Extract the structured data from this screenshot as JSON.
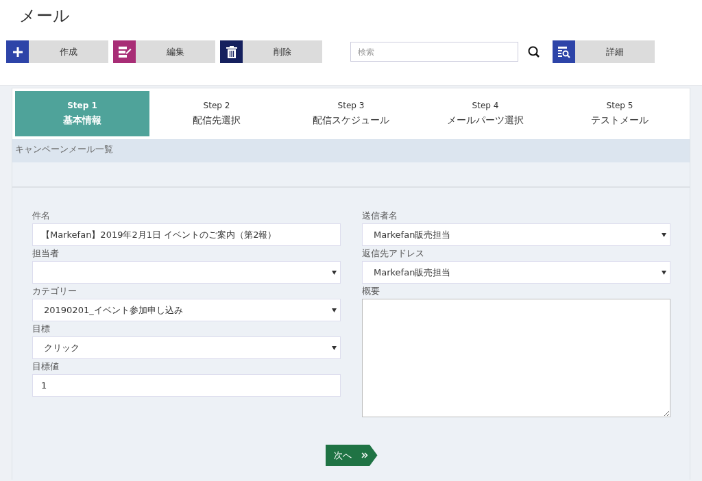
{
  "page": {
    "title": "メール"
  },
  "toolbar": {
    "buttons": [
      {
        "kind": "add",
        "label": "作成"
      },
      {
        "kind": "edit",
        "label": "編集"
      },
      {
        "kind": "delete",
        "label": "削除"
      }
    ],
    "search": {
      "placeholder": "検索"
    },
    "detail_button": {
      "kind": "detail",
      "label": "詳細"
    }
  },
  "steps": [
    {
      "step": "Step 1",
      "label": "基本情報",
      "selected": true
    },
    {
      "step": "Step 2",
      "label": "配信先選択",
      "selected": false
    },
    {
      "step": "Step 3",
      "label": "配信スケジュール",
      "selected": false
    },
    {
      "step": "Step 4",
      "label": "メールパーツ選択",
      "selected": false
    },
    {
      "step": "Step 5",
      "label": "テストメール",
      "selected": false
    }
  ],
  "section_heading": "キャンペーンメール一覧",
  "form": {
    "left": [
      {
        "kind": "text",
        "label": "件名",
        "value": "【Markefan】2019年2月1日 イベントのご案内（第2報）"
      },
      {
        "kind": "select",
        "label": "担当者"
      },
      {
        "kind": "select",
        "label": "カテゴリー",
        "value": "20190201_イベント参加申し込み"
      },
      {
        "kind": "select",
        "label": "目標",
        "value": "クリック"
      },
      {
        "kind": "text",
        "label": "目標値",
        "value": "1"
      }
    ],
    "right": [
      {
        "kind": "select",
        "label": "送信者名",
        "value": "Markefan販売担当"
      },
      {
        "kind": "select",
        "label": "返信先アドレス",
        "value": "Markefan販売担当"
      },
      {
        "kind": "textarea",
        "label": "概要"
      }
    ]
  },
  "next_button": {
    "label": "次へ"
  }
}
